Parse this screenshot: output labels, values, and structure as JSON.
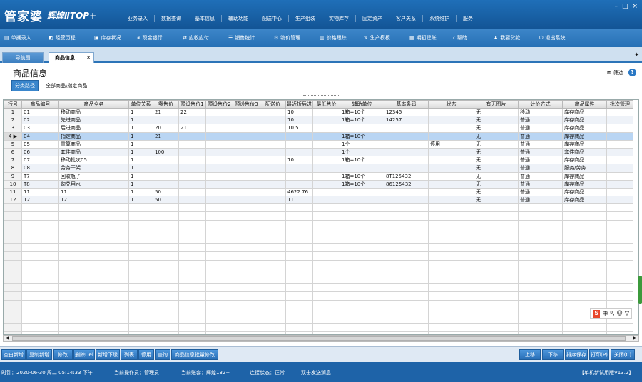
{
  "app": {
    "logo": "管家婆",
    "edition": "辉煌ⅡTOP+",
    "top_menu": [
      "业务录入",
      "数据查询",
      "基本信息",
      "辅助功能",
      "配送中心",
      "生产组装",
      "实物库存",
      "固定资产",
      "客户关系",
      "系统维护",
      "服务"
    ],
    "window_buttons": [
      "–",
      "□",
      "×"
    ]
  },
  "toolbar": [
    {
      "icon": "document-icon",
      "glyph": "▤",
      "label": "单据录入"
    },
    {
      "icon": "chart-icon",
      "glyph": "◩",
      "label": "经营历程"
    },
    {
      "icon": "inventory-icon",
      "glyph": "▣",
      "label": "库存状况"
    },
    {
      "icon": "yen-icon",
      "glyph": "¥",
      "label": "现金银行"
    },
    {
      "icon": "transfer-icon",
      "glyph": "⇄",
      "label": "应收应付"
    },
    {
      "icon": "sales-icon",
      "glyph": "☰",
      "label": "销售统计"
    },
    {
      "icon": "gear-icon",
      "glyph": "⚙",
      "label": "物价管理"
    },
    {
      "icon": "trend-icon",
      "glyph": "▥",
      "label": "价格跟踪"
    },
    {
      "icon": "wrench-icon",
      "glyph": "✎",
      "label": "生产模板"
    },
    {
      "icon": "calendar-icon",
      "glyph": "▦",
      "label": "期初建账"
    },
    {
      "icon": "help-icon",
      "glyph": "?",
      "label": "帮助"
    },
    {
      "icon": "user-icon",
      "glyph": "♟",
      "label": "我要贷款"
    },
    {
      "icon": "power-icon",
      "glyph": "⏻",
      "label": "退出系统"
    }
  ],
  "tabs": {
    "nav": "导航图",
    "active": "商品信息"
  },
  "panel": {
    "title": "商品信息",
    "crumb_button": "分类路径",
    "crumb_path": "全部商品\\指定商品",
    "filter_label": "筛选",
    "help": "?"
  },
  "grid": {
    "columns": [
      "行号",
      "商品编号",
      "商品全名",
      "单位关系",
      "零售价",
      "预设售价1",
      "预设售价2",
      "预设售价3",
      "配送价",
      "最近折后进",
      "最低售价",
      "辅助单位",
      "基本条码",
      "状态",
      "有无图片",
      "计价方式",
      "商品属性",
      "批次管理"
    ],
    "rows": [
      [
        "1",
        "01",
        "移动商品",
        "1",
        "21",
        "22",
        "",
        "",
        "",
        "10",
        "",
        "1箱=10个",
        "12345",
        "",
        "无",
        "移动",
        "库存商品",
        ""
      ],
      [
        "2",
        "02",
        "先进商品",
        "1",
        "",
        "",
        "",
        "",
        "",
        "10",
        "",
        "1箱=10个",
        "14257",
        "",
        "无",
        "普通",
        "库存商品",
        ""
      ],
      [
        "3",
        "03",
        "后进商品",
        "1",
        "20",
        "21",
        "",
        "",
        "",
        "10.5",
        "",
        "",
        "",
        "",
        "无",
        "普通",
        "库存商品",
        ""
      ],
      [
        "4",
        "04",
        "指定商品",
        "1",
        "21",
        "",
        "",
        "",
        "",
        "",
        "",
        "1箱=10个",
        "",
        "",
        "无",
        "普通",
        "库存商品",
        ""
      ],
      [
        "5",
        "05",
        "重算商品",
        "1",
        "",
        "",
        "",
        "",
        "",
        "",
        "",
        "1个",
        "",
        "停用",
        "无",
        "普通",
        "库存商品",
        ""
      ],
      [
        "6",
        "06",
        "套件商品",
        "1",
        "100",
        "",
        "",
        "",
        "",
        "",
        "",
        "1个",
        "",
        "",
        "无",
        "普通",
        "套件商品",
        ""
      ],
      [
        "7",
        "07",
        "移动批次05",
        "1",
        "",
        "",
        "",
        "",
        "",
        "10",
        "",
        "1箱=10个",
        "",
        "",
        "无",
        "普通",
        "库存商品",
        ""
      ],
      [
        "8",
        "08",
        "劳务干架",
        "1",
        "",
        "",
        "",
        "",
        "",
        "",
        "",
        "",
        "",
        "",
        "无",
        "普通",
        "服务/劳务",
        ""
      ],
      [
        "9",
        "T7",
        "回收瓶子",
        "1",
        "",
        "",
        "",
        "",
        "",
        "",
        "",
        "1箱=10个",
        "8T125432",
        "",
        "无",
        "普通",
        "库存商品",
        ""
      ],
      [
        "10",
        "T8",
        "勾兑用水",
        "1",
        "",
        "",
        "",
        "",
        "",
        "",
        "",
        "1箱=10个",
        "86125432",
        "",
        "无",
        "普通",
        "库存商品",
        ""
      ],
      [
        "11",
        "11",
        "11",
        "1",
        "50",
        "",
        "",
        "",
        "",
        "4622.76",
        "",
        "",
        "",
        "",
        "无",
        "普通",
        "库存商品",
        ""
      ],
      [
        "12",
        "12",
        "12",
        "1",
        "50",
        "",
        "",
        "",
        "",
        "11",
        "",
        "",
        "",
        "",
        "无",
        "普通",
        "库存商品",
        ""
      ]
    ],
    "selected_row": 4,
    "current_marker": "4 ▶"
  },
  "actions_left": [
    "空白新增",
    "复制新增",
    "修改",
    "删除Del",
    "新增下级",
    "列表",
    "停用",
    "查询",
    "商品信息批量修改"
  ],
  "actions_right": [
    "上移",
    "下移",
    "排序保存",
    "打印(P)",
    "关闭(C)"
  ],
  "ime": {
    "s": "S",
    "items": [
      "中",
      "º,",
      "☺",
      "▽"
    ]
  },
  "status": {
    "time": "时钟：2020-06-30 周二 05:14:33 下午",
    "operator": "当前操作员：管理员",
    "account": "当前账套：辉煌132+",
    "connection": "连接状态：正常",
    "message": "双击发送消息!",
    "version": "【单机新试用版V13.2】"
  },
  "colors": {
    "primary": "#1e63a8",
    "selected_row": "#b9d5f3",
    "alt_row": "#eef2f8"
  }
}
